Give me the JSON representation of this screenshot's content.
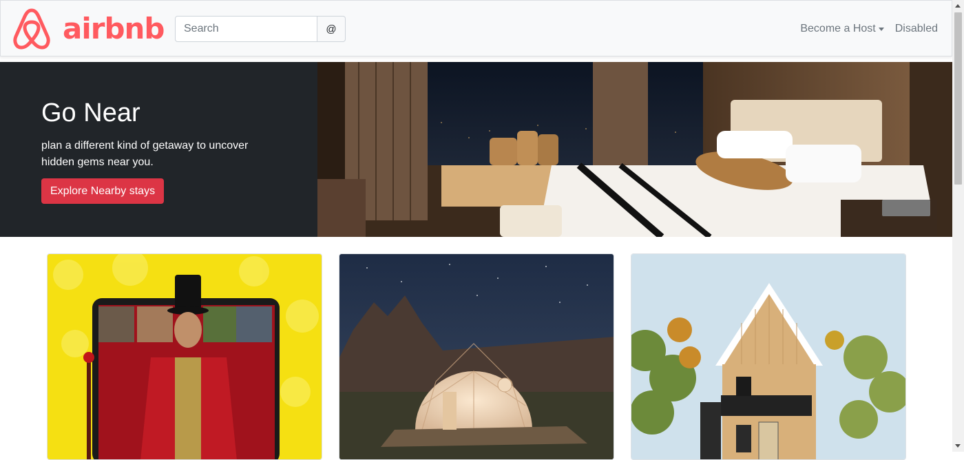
{
  "navbar": {
    "brand": "airbnb",
    "search": {
      "placeholder": "Search",
      "button_label": "@"
    },
    "links": [
      {
        "label": "Become a Host"
      },
      {
        "label": "Disabled"
      }
    ]
  },
  "hero": {
    "title": "Go Near",
    "subtitle": "plan a different kind of getaway to uncover hidden gems near you.",
    "button_label": "Explore Nearby stays"
  },
  "colors": {
    "brand": "#ff5a5f",
    "hero_bg": "#212529",
    "button_danger": "#dc3545",
    "navbar_bg": "#f8f9fa"
  },
  "cards": [
    {
      "image": "online-experience-entertainer"
    },
    {
      "image": "geodesic-dome-night"
    },
    {
      "image": "a-frame-cabin"
    }
  ]
}
